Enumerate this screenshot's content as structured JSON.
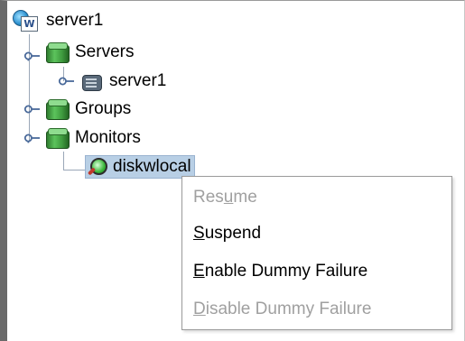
{
  "tree": {
    "root": {
      "label": "server1",
      "icon": "cluster-root-icon",
      "icon_letter": "W"
    },
    "servers": {
      "label": "Servers",
      "icon": "group-icon"
    },
    "server_item": {
      "label": "server1",
      "icon": "server-icon"
    },
    "groups": {
      "label": "Groups",
      "icon": "group-icon"
    },
    "monitors": {
      "label": "Monitors",
      "icon": "group-icon"
    },
    "monitor_item": {
      "label": "diskwlocal",
      "icon": "monitor-icon",
      "selected": true
    }
  },
  "context_menu": {
    "items": [
      {
        "pre": "Res",
        "mnemonic": "u",
        "post": "me",
        "enabled": false
      },
      {
        "pre": "",
        "mnemonic": "S",
        "post": "uspend",
        "enabled": true
      },
      {
        "pre": "",
        "mnemonic": "E",
        "post": "nable Dummy Failure",
        "enabled": true
      },
      {
        "pre": "",
        "mnemonic": "D",
        "post": "isable Dummy Failure",
        "enabled": false
      }
    ]
  },
  "colors": {
    "selection_bg": "#b8cfe5",
    "disabled_text": "#a0a0a0",
    "tree_line": "#9aa7b8"
  }
}
